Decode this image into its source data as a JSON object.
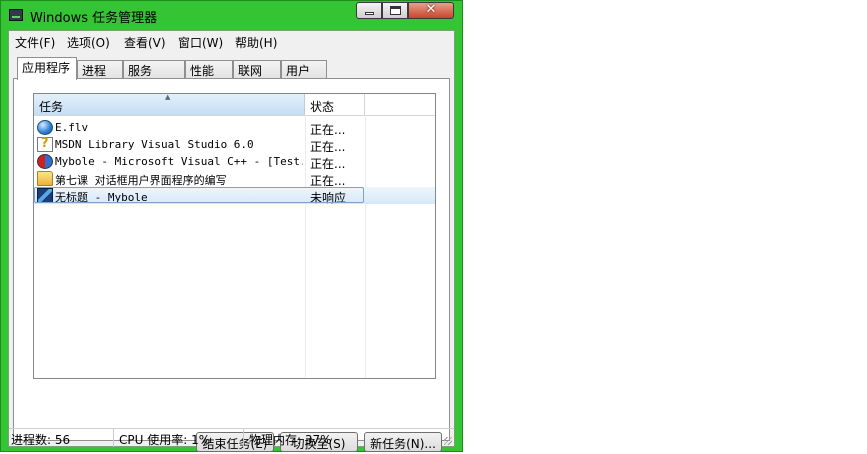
{
  "window": {
    "title": "Windows 任务管理器",
    "close_label": "✕"
  },
  "menu": [
    "文件(F)",
    "选项(O)",
    "查看(V)",
    "窗口(W)",
    "帮助(H)"
  ],
  "tabs": [
    "应用程序",
    "进程",
    "服务",
    "性能",
    "联网",
    "用户"
  ],
  "active_tab": "应用程序",
  "list": {
    "columns": {
      "task": "任务",
      "status": "状态"
    },
    "sort_indicator": "▲",
    "rows": [
      {
        "task": "E.flv",
        "status": "正在...",
        "icon": "globe-icon"
      },
      {
        "task": "MSDN Library Visual Studio 6.0",
        "status": "正在...",
        "icon": "help-icon"
      },
      {
        "task": "Mybole - Microsoft Visual C++ - [Test...",
        "status": "正在...",
        "icon": "visual-cpp-icon"
      },
      {
        "task": "第七课 对话框用户界面程序的编写",
        "status": "正在...",
        "icon": "folder-icon"
      },
      {
        "task": "无标题 - Mybole",
        "status": "未响应",
        "icon": "mybole-app-icon",
        "selected": true
      }
    ]
  },
  "buttons": {
    "end_task": "结束任务(E)",
    "switch_to": "切换至(S)",
    "new_task": "新任务(N)..."
  },
  "statusbar": {
    "processes": "进程数: 56",
    "cpu": "CPU 使用率: 1%",
    "memory": "物理内存: 37%"
  },
  "colors": {
    "frame": "#34c434",
    "selection": "#d6e8f8",
    "header": "#c6ddf3"
  }
}
